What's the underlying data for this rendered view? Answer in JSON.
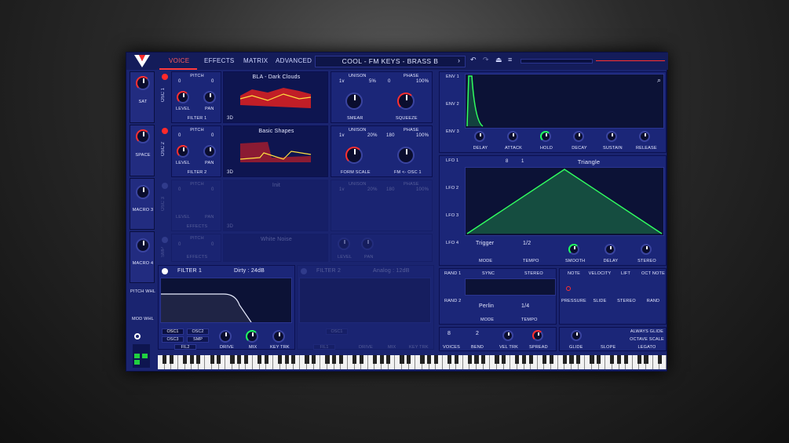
{
  "tabs": [
    "VOICE",
    "EFFECTS",
    "MATRIX",
    "ADVANCED"
  ],
  "preset": "COOL - FM KEYS - BRASS B",
  "sidebar": [
    "SAT",
    "SPACE",
    "MACRO 3",
    "MACRO 4",
    "PITCH WHL",
    "MOD WHL"
  ],
  "osc1": {
    "label": "OSC 1",
    "pitch": "PITCH",
    "p1": "0",
    "p2": "0",
    "level": "LEVEL",
    "pan": "PAN",
    "filter": "FILTER 1",
    "wave": "BLA - Dark Clouds",
    "unison": "UNISON",
    "voices": "1v",
    "det": "5%",
    "phase": "PHASE",
    "ph1": "0",
    "ph2": "100%",
    "smear": "SMEAR",
    "squeeze": "SQUEEZE",
    "d3": "3D"
  },
  "osc2": {
    "label": "OSC 2",
    "pitch": "PITCH",
    "p1": "0",
    "p2": "0",
    "level": "LEVEL",
    "pan": "PAN",
    "filter": "FILTER 2",
    "wave": "Basic Shapes",
    "unison": "UNISON",
    "voices": "1v",
    "det": "20%",
    "phase": "PHASE",
    "ph1": "180",
    "ph2": "100%",
    "formscale": "FORM SCALE",
    "fm": "FM <- OSC 1",
    "d3": "3D"
  },
  "osc3": {
    "label": "OSC 3",
    "pitch": "PITCH",
    "p1": "0",
    "p2": "0",
    "level": "LEVEL",
    "pan": "PAN",
    "filter": "EFFECTS",
    "wave": "Init",
    "unison": "UNISON",
    "voices": "1v",
    "det": "20%",
    "phase": "PHASE",
    "ph1": "180",
    "ph2": "100%",
    "d3": "3D"
  },
  "smp": {
    "label": "SMP",
    "pitch": "PITCH",
    "p1": "0",
    "p2": "0",
    "effects": "EFFECTS",
    "sample": "White Noise",
    "level": "LEVEL",
    "pan": "PAN"
  },
  "filter1": {
    "label": "FILTER 1",
    "type": "Dirty : 24dB",
    "osc1": "OSC1",
    "osc2": "OSC2",
    "osc3": "OSC3",
    "smp": "SMP",
    "fil2": "FIL2",
    "drive": "DRIVE",
    "mix": "MIX",
    "keytrk": "KEY TRK"
  },
  "filter2": {
    "label": "FILTER 2",
    "type": "Analog : 12dB",
    "osc1": "OSC1",
    "fil1": "FIL1",
    "drive": "DRIVE",
    "mix": "MIX",
    "keytrk": "KEY TRK"
  },
  "env": {
    "tabs": [
      "ENV 1",
      "ENV 2",
      "ENV 3"
    ],
    "knobs": [
      "DELAY",
      "ATTACK",
      "HOLD",
      "DECAY",
      "SUSTAIN",
      "RELEASE"
    ]
  },
  "lfo": {
    "tabs": [
      "LFO 1",
      "LFO 2",
      "LFO 3",
      "LFO 4"
    ],
    "shape": "Triangle",
    "grid1": "8",
    "grid2": "1",
    "trigger": "Trigger",
    "mode": "MODE",
    "rate": "1/2",
    "tempo": "TEMPO",
    "knobs": [
      "SMOOTH",
      "DELAY",
      "STEREO"
    ]
  },
  "rand": {
    "tabs": [
      "RAND 1",
      "RAND 2"
    ],
    "sync": "SYNC",
    "stereo": "STEREO",
    "style": "Perlin",
    "mode": "MODE",
    "rate": "1/4",
    "tempo": "TEMPO"
  },
  "mods": {
    "top": [
      "NOTE",
      "VELOCITY",
      "LIFT",
      "OCT NOTE"
    ],
    "bottom": [
      "PRESSURE",
      "SLIDE",
      "STEREO",
      "RAND"
    ]
  },
  "voice": {
    "voices": "8",
    "bend": "2",
    "voicesLbl": "VOICES",
    "bendLbl": "BEND",
    "veltrk": "VEL TRK",
    "spread": "SPREAD",
    "glide": "GLIDE",
    "slope": "SLOPE",
    "opts": [
      "ALWAYS GLIDE",
      "OCTAVE SCALE",
      "LEGATO"
    ]
  }
}
